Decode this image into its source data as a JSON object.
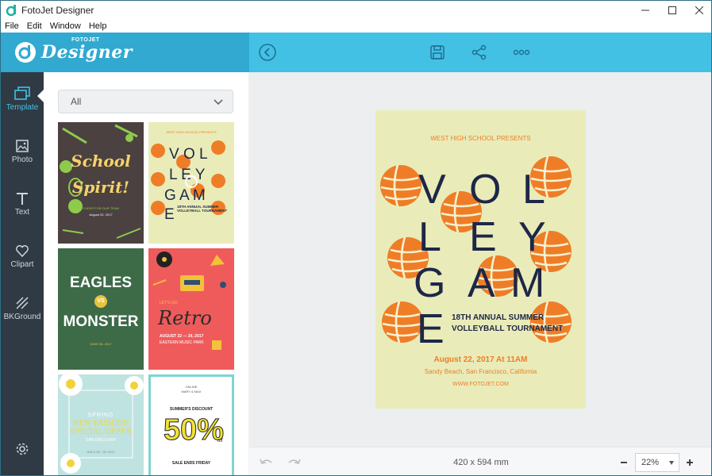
{
  "window": {
    "title": "FotoJet Designer"
  },
  "menu": [
    "File",
    "Edit",
    "Window",
    "Help"
  ],
  "header": {
    "logo_small": "FOTOJET",
    "logo_big": "Designer"
  },
  "rail": [
    {
      "label": "Template",
      "icon": "template-icon",
      "active": true
    },
    {
      "label": "Photo",
      "icon": "photo-icon"
    },
    {
      "label": "Text",
      "icon": "text-icon"
    },
    {
      "label": "Clipart",
      "icon": "heart-icon"
    },
    {
      "label": "BKGround",
      "icon": "background-icon"
    }
  ],
  "panel": {
    "category": "All",
    "thumbnails": [
      {
        "name": "school-spirit",
        "line1": "School",
        "line2": "Spirit!",
        "sub": "CHEER FOR OUR TEAM",
        "date": "August 22, 2017"
      },
      {
        "name": "volleyball",
        "top": "WEST HIGH SCHOOL PRESENTS",
        "big": "VOLLEY GAME",
        "sub": "18TH ANNUAL SUMMER VOLLEYBALL TOURNAMENT"
      },
      {
        "name": "eagles-monster",
        "l1": "EAGLES",
        "vs": "VS",
        "l2": "MONSTER",
        "date": "JUNE 08, 2017"
      },
      {
        "name": "retro",
        "top": "LET'S GO",
        "big": "Retro",
        "date": "AUGUST 22 — 24, 2017",
        "sub": "EASTERN MUSIC PARK"
      },
      {
        "name": "spring-fashion",
        "l1": "SPRING",
        "l2": "NEW FASHION",
        "l3": "SPECIAL OFFER",
        "l4": "SAN DISCOUNT",
        "date": "HOLD 05 - 20, 2017"
      },
      {
        "name": "summer-discount",
        "top": "ONLINE",
        "brand": "MARY & MAX",
        "head": "SUMMER'S DISCOUNT",
        "big": "50%",
        "off": "off",
        "foot": "SALE ENDS FRIDAY"
      }
    ]
  },
  "poster": {
    "presents": "WEST HIGH SCHOOL PRESENTS",
    "letters": [
      "V",
      "O",
      "L",
      "L",
      "E",
      "Y",
      "G",
      "A",
      "M",
      "E"
    ],
    "subtitle_1": "18TH ANNUAL SUMMER",
    "subtitle_2": "VOLLEYBALL TOURNAMENT",
    "date": "August 22, 2017 At 11AM",
    "location": "Sandy Beach, San Francisco, California",
    "website": "WWW.FOTOJET.COM",
    "colors": {
      "background": "#e9ecb8",
      "accent": "#ef7d27",
      "text": "#1e2747"
    }
  },
  "bottom": {
    "size": "420 x 594 mm",
    "zoom": "22%"
  }
}
